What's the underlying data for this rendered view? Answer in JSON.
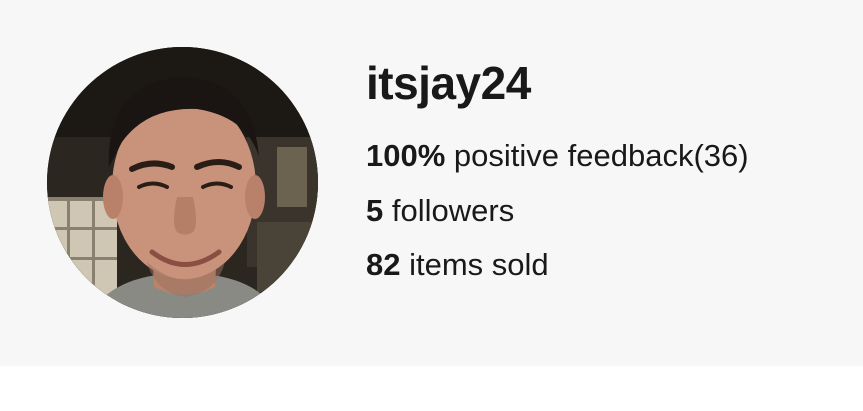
{
  "profile": {
    "username": "itsjay24",
    "avatar_icon": "profile-photo",
    "feedback": {
      "percent": "100%",
      "label": "positive feedback",
      "count": "(36)"
    },
    "followers": {
      "value": "5",
      "label": "followers"
    },
    "items_sold": {
      "value": "82",
      "label": "items sold"
    }
  },
  "colors": {
    "card_background": "#f7f7f7",
    "page_background": "#ffffff",
    "text": "#191919"
  }
}
